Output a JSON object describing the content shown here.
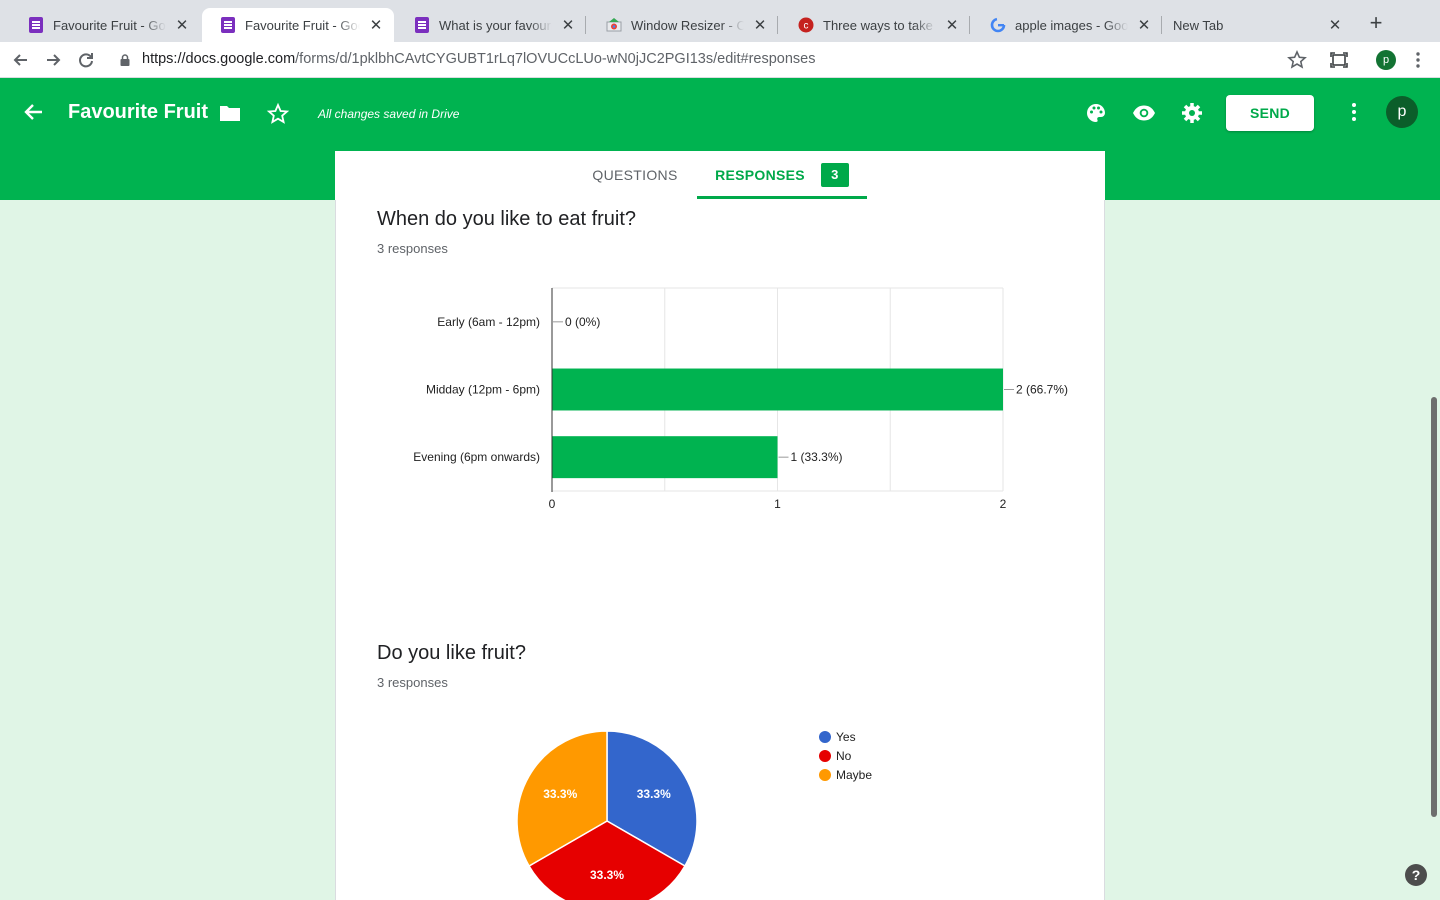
{
  "browser": {
    "tabs": [
      {
        "title": "Favourite Fruit - Google Forms",
        "icon": "forms-icon",
        "active": false
      },
      {
        "title": "Favourite Fruit - Google Forms",
        "icon": "forms-icon",
        "active": true
      },
      {
        "title": "What is your favourite fruit?",
        "icon": "forms-icon",
        "active": false
      },
      {
        "title": "Window Resizer - Chrome Web Store",
        "icon": "chrome-store-icon",
        "active": false
      },
      {
        "title": "Three ways to take a screenshot",
        "icon": "red-c-icon",
        "active": false
      },
      {
        "title": "apple images - Google Search",
        "icon": "google-icon",
        "active": false
      },
      {
        "title": "New Tab",
        "icon": "",
        "active": false
      }
    ],
    "url_host": "https://docs.google.com",
    "url_path": "/forms/d/1pklbhCAvtCYGUBT1rLq7lOVUCcLUo-wN0jJC2PGI13s/edit#responses",
    "profile_initial": "p"
  },
  "header": {
    "title": "Favourite Fruit",
    "saved_status": "All changes saved in Drive",
    "send_label": "SEND",
    "avatar_initial": "p",
    "accent": "#00b350"
  },
  "view_tabs": {
    "questions_label": "QUESTIONS",
    "responses_label": "RESPONSES",
    "response_count": "3"
  },
  "questions": [
    {
      "title": "When do you like to eat fruit?",
      "subtitle": "3 responses"
    },
    {
      "title": "Do you like fruit?",
      "subtitle": "3 responses"
    }
  ],
  "chart_data": [
    {
      "type": "bar",
      "orientation": "horizontal",
      "categories": [
        "Early (6am - 12pm)",
        "Midday (12pm - 6pm)",
        "Evening (6pm onwards)"
      ],
      "values": [
        0,
        2,
        1
      ],
      "labels": [
        "0 (0%)",
        "2 (66.7%)",
        "1 (33.3%)"
      ],
      "xlim": [
        0,
        2
      ],
      "xticks": [
        "0",
        "1",
        "2"
      ],
      "color": "#00b350",
      "grid": true
    },
    {
      "type": "pie",
      "categories": [
        "Yes",
        "No",
        "Maybe"
      ],
      "values": [
        33.3,
        33.3,
        33.3
      ],
      "labels": [
        "33.3%",
        "33.3%",
        "33.3%"
      ],
      "colors": [
        "#3366cc",
        "#e60000",
        "#ff9900"
      ],
      "legend_position": "right"
    }
  ]
}
